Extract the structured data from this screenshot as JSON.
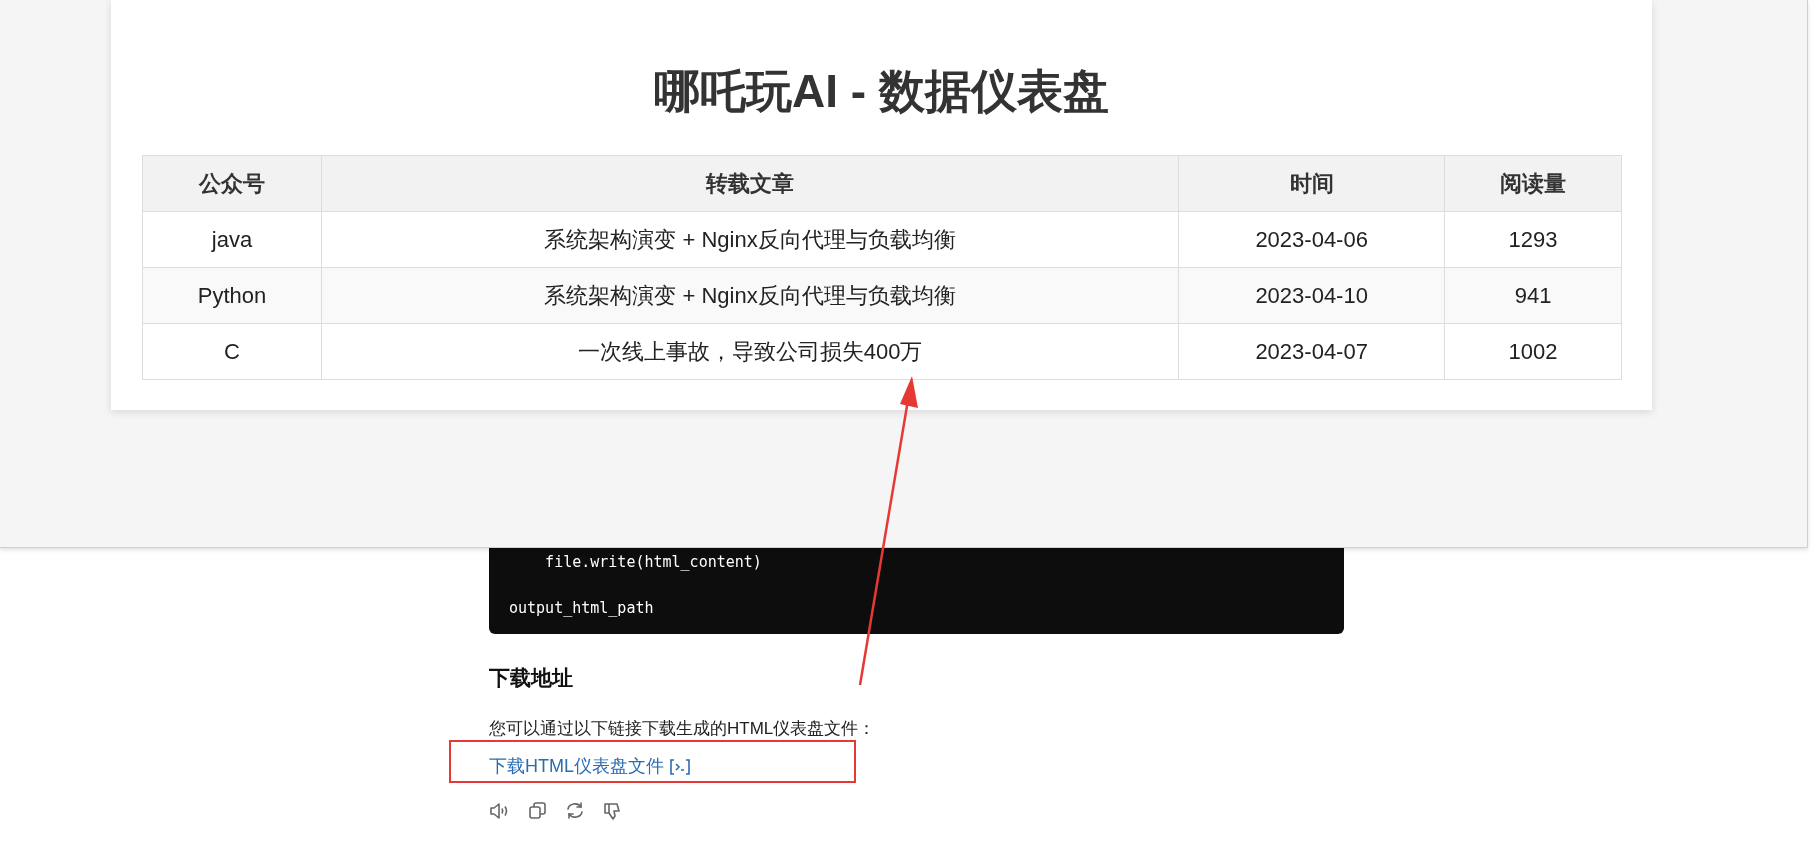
{
  "dashboard": {
    "title": "哪吒玩AI - 数据仪表盘",
    "table": {
      "columns": [
        "公众号",
        "转载文章",
        "时间",
        "阅读量"
      ],
      "rows": [
        [
          "java",
          "系统架构演变 + Nginx反向代理与负载均衡",
          "2023-04-06",
          "1293"
        ],
        [
          "Python",
          "系统架构演变 + Nginx反向代理与负载均衡",
          "2023-04-10",
          "941"
        ],
        [
          "C",
          "一次线上事故，导致公司损失400万",
          "2023-04-07",
          "1002"
        ]
      ]
    }
  },
  "code_block": {
    "lines": [
      "    file.write(html_content)",
      "output_html_path"
    ]
  },
  "section": {
    "heading": "下载地址",
    "text": "您可以通过以下链接下载生成的HTML仪表盘文件：",
    "link": "下载HTML仪表盘文件"
  }
}
